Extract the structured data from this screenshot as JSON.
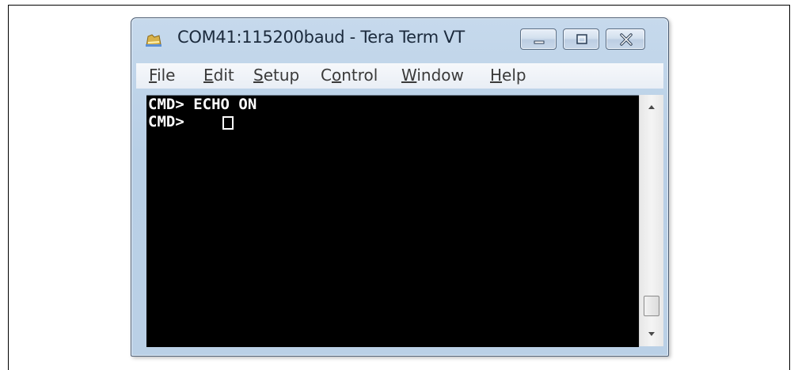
{
  "window": {
    "title": "COM41:115200baud - Tera Term VT"
  },
  "menu": [
    {
      "accel": "F",
      "rest": "ile"
    },
    {
      "accel": "E",
      "rest": "dit"
    },
    {
      "accel": "S",
      "rest": "etup"
    },
    {
      "pre": "C",
      "accel": "o",
      "rest": "ntrol"
    },
    {
      "accel": "W",
      "rest": "indow"
    },
    {
      "accel": "H",
      "rest": "elp"
    }
  ],
  "terminal": {
    "lines": [
      "CMD> ECHO ON",
      "CMD> "
    ]
  },
  "icons": {
    "app": "tera-term-icon",
    "minimize": "minimize-icon",
    "maximize": "maximize-icon",
    "close": "close-icon",
    "scroll_up": "arrow-up-icon",
    "scroll_down": "arrow-down-icon"
  }
}
